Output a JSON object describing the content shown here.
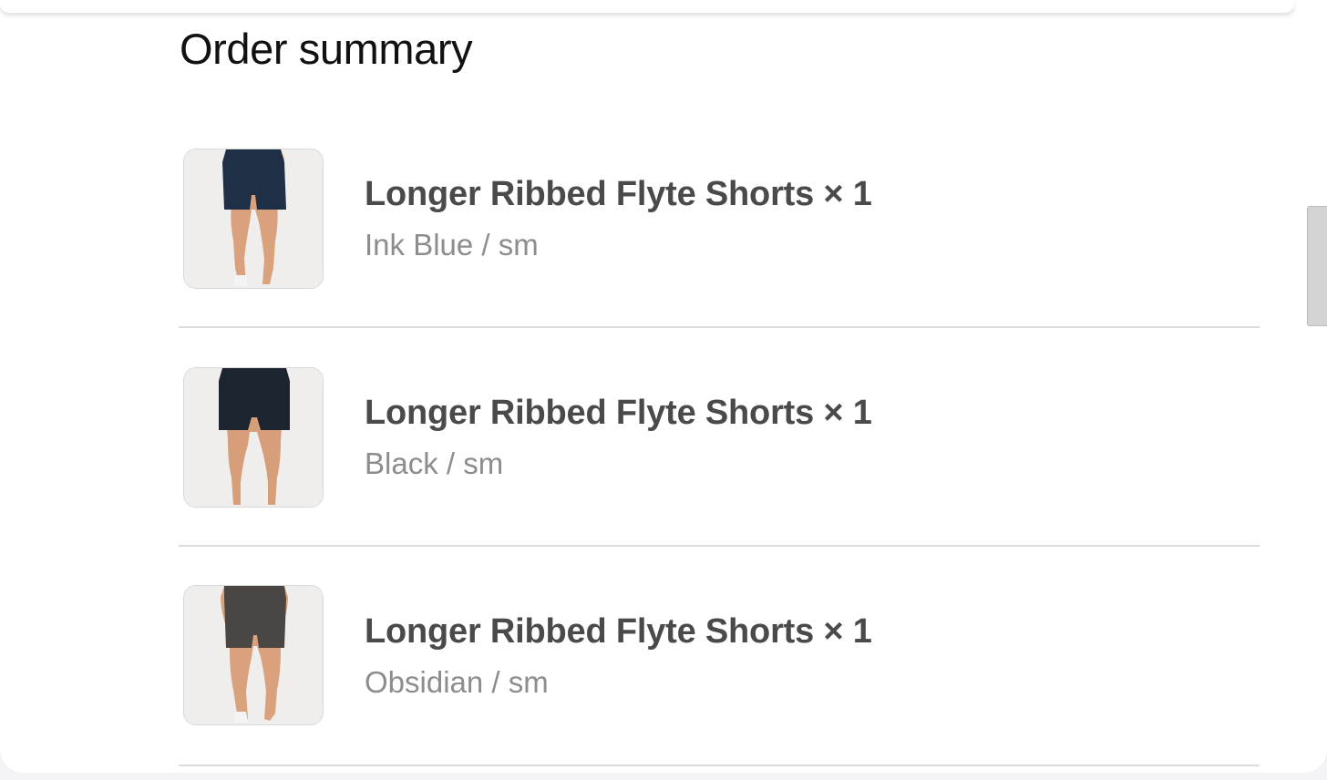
{
  "order_summary": {
    "title": "Order summary",
    "items": [
      {
        "name": "Longer Ribbed Flyte Shorts × 1",
        "variant": "Ink Blue / sm",
        "color": "#1f2f45"
      },
      {
        "name": "Longer Ribbed Flyte Shorts × 1",
        "variant": "Black / sm",
        "color": "#1c2430"
      },
      {
        "name": "Longer Ribbed Flyte Shorts × 1",
        "variant": "Obsidian / sm",
        "color": "#4a4644"
      }
    ]
  }
}
